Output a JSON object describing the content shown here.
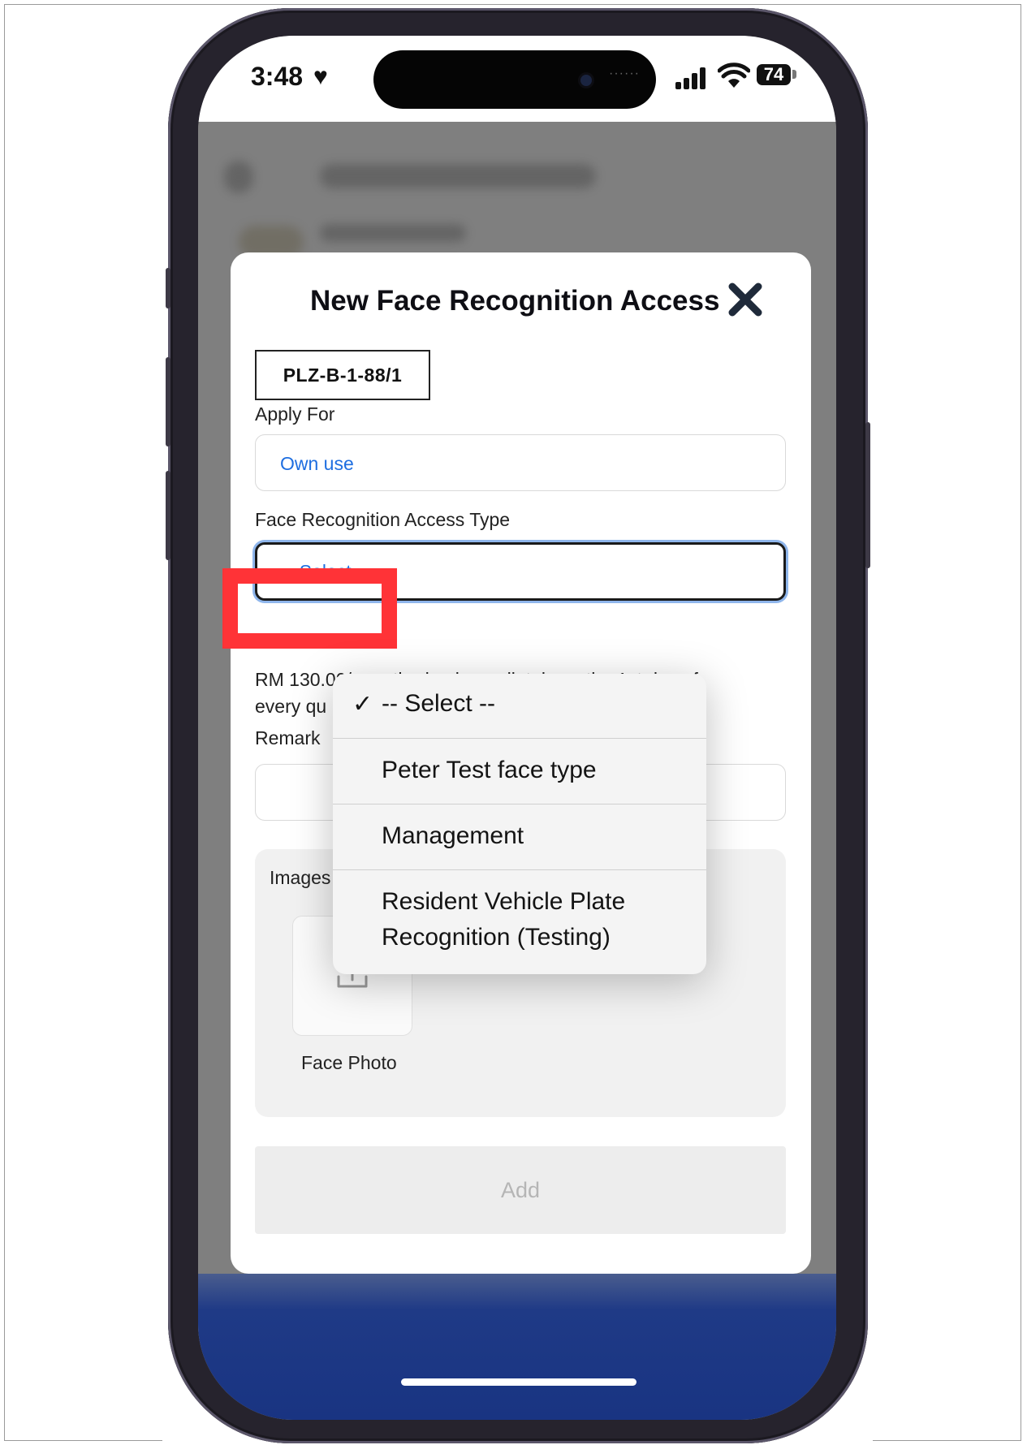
{
  "status_bar": {
    "time": "3:48",
    "battery": "74",
    "icons": [
      "heart-icon",
      "signal-icon",
      "wifi-icon",
      "battery-icon"
    ]
  },
  "modal": {
    "title": "New Face Recognition Access",
    "close_icon": "close-icon",
    "unit": "PLZ-B-1-88/1",
    "apply_for": {
      "label": "Apply For",
      "value": "Own use"
    },
    "access_type": {
      "label": "Face Recognition Access Type",
      "value": "-- Select --"
    },
    "fee_note": {
      "line1": "RM 130.00/ month, due immediately on the 1st day of",
      "line2": "every qu"
    },
    "remark": {
      "label": "Remark",
      "value": ""
    },
    "images": {
      "label": "Images",
      "upload_icon": "upload-icon",
      "tile_caption": "Face Photo"
    },
    "add_button": "Add"
  },
  "dropdown": {
    "selected_index": 0,
    "options": [
      {
        "label": "-- Select --",
        "checked": true
      },
      {
        "label": "Peter Test face type",
        "checked": false
      },
      {
        "label": "Management",
        "checked": false
      },
      {
        "label_line1": "Resident Vehicle Plate",
        "label_line2": "Recognition (Testing)",
        "checked": false
      }
    ]
  },
  "colors": {
    "accent_blue": "#1e6ee0",
    "highlight_red": "#ff3337",
    "bottom_bar": "#193482",
    "disabled_text": "#b5b5b5"
  }
}
